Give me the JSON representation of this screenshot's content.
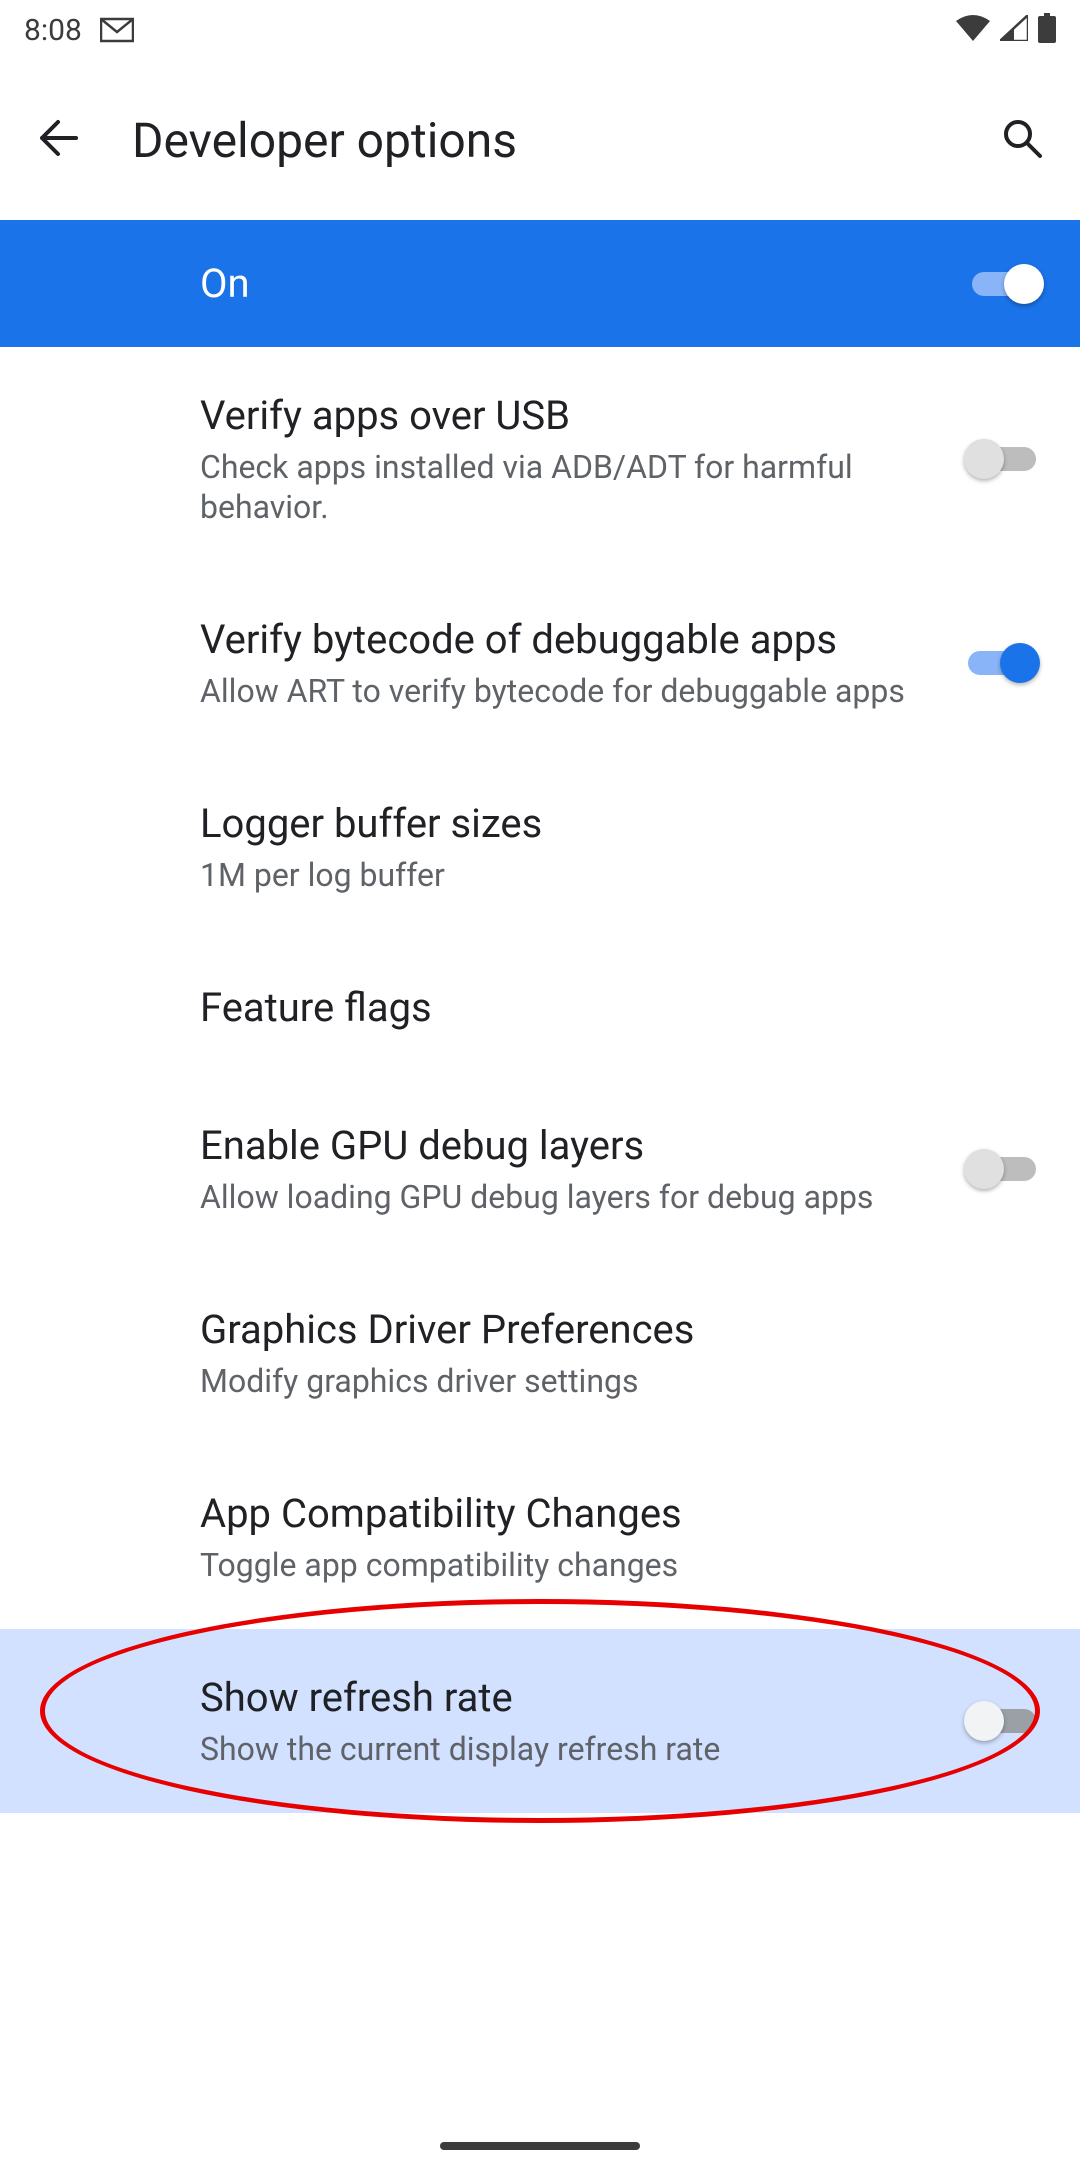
{
  "status": {
    "time": "8:08"
  },
  "header": {
    "title": "Developer options"
  },
  "master": {
    "label": "On",
    "enabled": true
  },
  "items": [
    {
      "title": "Verify apps over USB",
      "subtitle": "Check apps installed via ADB/ADT for harmful behavior.",
      "toggle": "off"
    },
    {
      "title": "Verify bytecode of debuggable apps",
      "subtitle": "Allow ART to verify bytecode for debuggable apps",
      "toggle": "on"
    },
    {
      "title": "Logger buffer sizes",
      "subtitle": "1M per log buffer",
      "toggle": null
    },
    {
      "title": "Feature flags",
      "subtitle": null,
      "toggle": null
    },
    {
      "title": "Enable GPU debug layers",
      "subtitle": "Allow loading GPU debug layers for debug apps",
      "toggle": "off"
    },
    {
      "title": "Graphics Driver Preferences",
      "subtitle": "Modify graphics driver settings",
      "toggle": null
    },
    {
      "title": "App Compatibility Changes",
      "subtitle": "Toggle app compatibility changes",
      "toggle": null
    },
    {
      "title": "Show refresh rate",
      "subtitle": "Show the current display refresh rate",
      "toggle": "off",
      "highlighted": true
    }
  ]
}
